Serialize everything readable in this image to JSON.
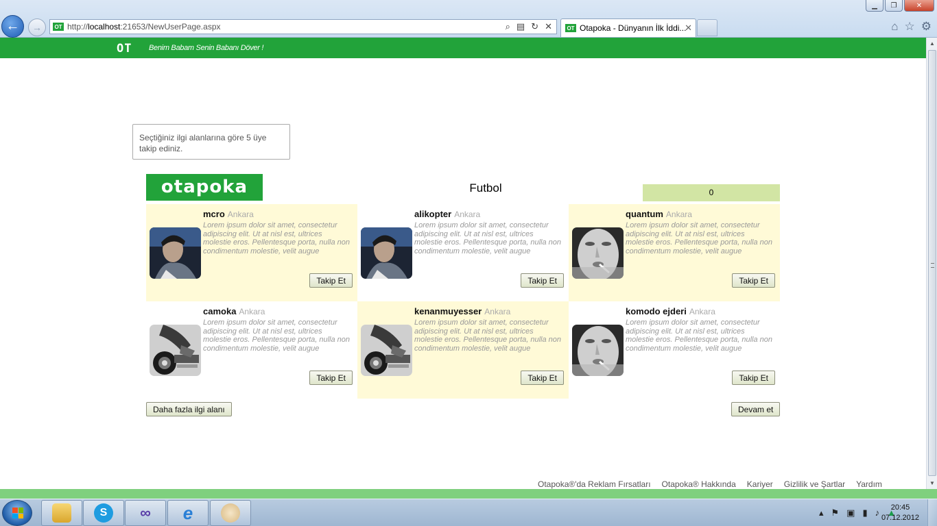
{
  "browser": {
    "url_prefix": "http://",
    "url_host": "localhost",
    "url_path": ":21653/NewUserPage.aspx",
    "tab_title": "Otapoka - Dünyanın İlk İddi...",
    "favicon_text": "OT"
  },
  "header": {
    "logo_text": "OT",
    "slogan": "Benim Babam Senin Babanı Döver !"
  },
  "hint": "Seçtiğiniz ilgi alanlarına göre 5 üye takip ediniz.",
  "brand": "otapoka",
  "category": "Futbol",
  "follow_count": "0",
  "users": [
    {
      "name": "mcro",
      "city": "Ankara",
      "bio": "Lorem ipsum dolor sit amet, consectetur adipiscing elit. Ut at nisl est, ultrices molestie eros. Pellentesque porta, nulla non condimentum molestie, velit augue",
      "button": "Takip Et",
      "avatar": "man-portrait"
    },
    {
      "name": "alikopter",
      "city": "Ankara",
      "bio": "Lorem ipsum dolor sit amet, consectetur adipiscing elit. Ut at nisl est, ultrices molestie eros. Pellentesque porta, nulla non condimentum molestie, velit augue",
      "button": "Takip Et",
      "avatar": "man-portrait"
    },
    {
      "name": "quantum",
      "city": "Ankara",
      "bio": "Lorem ipsum dolor sit amet, consectetur adipiscing elit. Ut at nisl est, ultrices molestie eros. Pellentesque porta, nulla non condimentum molestie, velit augue",
      "button": "Takip Et",
      "avatar": "smoking-face"
    },
    {
      "name": "camoka",
      "city": "Ankara",
      "bio": "Lorem ipsum dolor sit amet, consectetur adipiscing elit. Ut at nisl est, ultrices molestie eros. Pellentesque porta, nulla non condimentum molestie, velit augue",
      "button": "Takip Et",
      "avatar": "motorcycle"
    },
    {
      "name": "kenanmuyesser",
      "city": "Ankara",
      "bio": "Lorem ipsum dolor sit amet, consectetur adipiscing elit. Ut at nisl est, ultrices molestie eros. Pellentesque porta, nulla non condimentum molestie, velit augue",
      "button": "Takip Et",
      "avatar": "motorcycle"
    },
    {
      "name": "komodo ejderi",
      "city": "Ankara",
      "bio": "Lorem ipsum dolor sit amet, consectetur adipiscing elit. Ut at nisl est, ultrices molestie eros. Pellentesque porta, nulla non condimentum molestie, velit augue",
      "button": "Takip Et",
      "avatar": "smoking-face"
    }
  ],
  "actions": {
    "more_interests": "Daha fazla ilgi alanı",
    "continue": "Devam et"
  },
  "footer": {
    "links": [
      "Otapoka®'da Reklam Fırsatları",
      "Otapoka® Hakkında",
      "Kariyer",
      "Gizlilik ve Şartlar",
      "Yardım"
    ]
  },
  "taskbar": {
    "time": "20:45",
    "date": "07.12.2012"
  },
  "colors": {
    "brand_green": "#22a33a",
    "highlight_yellow": "#fffad7",
    "counter_green": "#d2e5a4",
    "strip_green": "#7fd07e"
  }
}
